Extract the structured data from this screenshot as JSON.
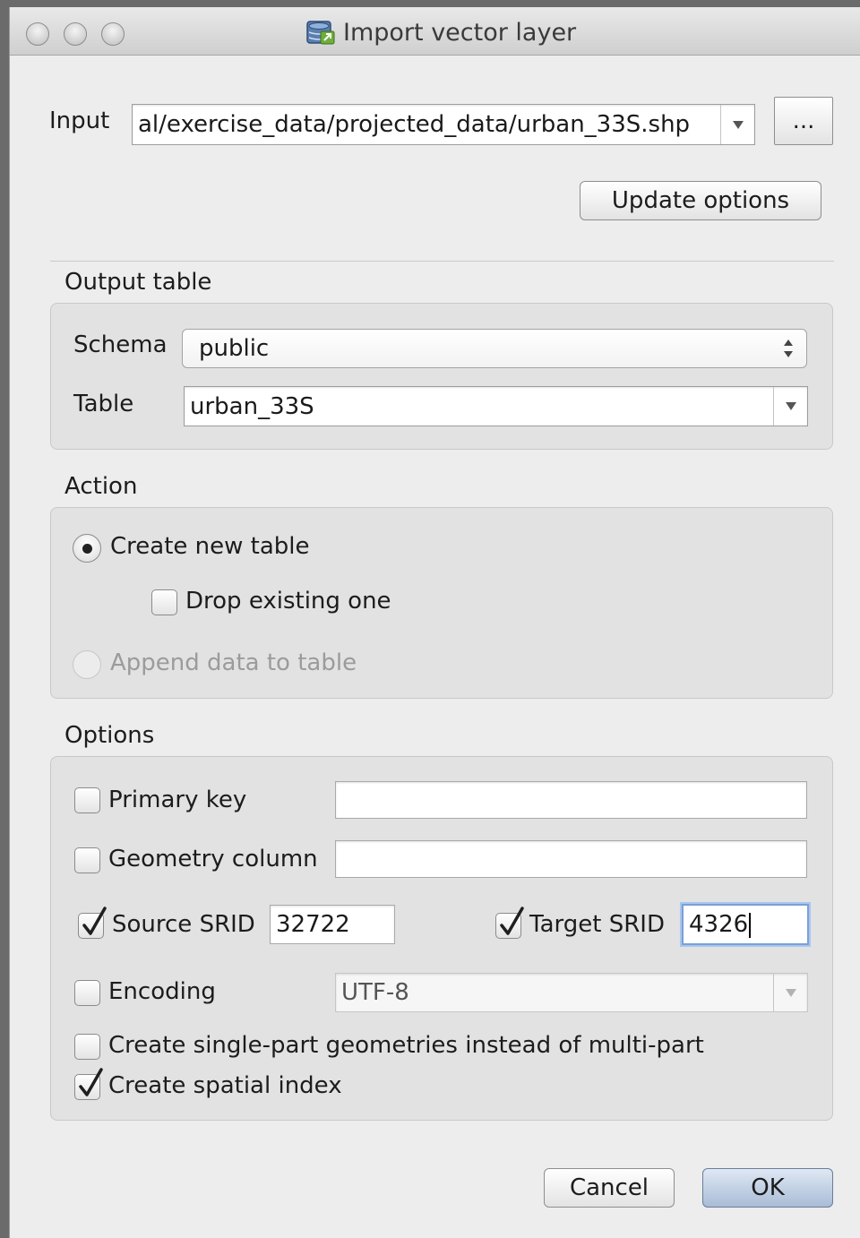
{
  "window": {
    "title": "Import vector layer"
  },
  "input": {
    "label": "Input",
    "value": "al/exercise_data/projected_data/urban_33S.shp",
    "browse_label": "...",
    "update_options_label": "Update options"
  },
  "output_table": {
    "title": "Output table",
    "schema_label": "Schema",
    "schema_value": "public",
    "table_label": "Table",
    "table_value": "urban_33S"
  },
  "action": {
    "title": "Action",
    "create_new_table": {
      "label": "Create new table",
      "selected": true
    },
    "drop_existing": {
      "label": "Drop existing one",
      "checked": false
    },
    "append_data": {
      "label": "Append data to table",
      "selected": false,
      "enabled": false
    }
  },
  "options": {
    "title": "Options",
    "primary_key": {
      "label": "Primary key",
      "checked": false,
      "value": ""
    },
    "geometry_column": {
      "label": "Geometry column",
      "checked": false,
      "value": ""
    },
    "source_srid": {
      "label": "Source SRID",
      "checked": true,
      "value": "32722"
    },
    "target_srid": {
      "label": "Target SRID",
      "checked": true,
      "value": "4326"
    },
    "encoding": {
      "label": "Encoding",
      "checked": false,
      "value": "UTF-8"
    },
    "single_part": {
      "label": "Create single-part geometries instead of multi-part",
      "checked": false
    },
    "spatial_index": {
      "label": "Create spatial index",
      "checked": true
    }
  },
  "buttons": {
    "cancel_label": "Cancel",
    "ok_label": "OK"
  },
  "colors": {
    "default_button": "#a9bcd6",
    "focus_ring": "#7aa0d6",
    "group_bg": "#e2e2e2"
  }
}
